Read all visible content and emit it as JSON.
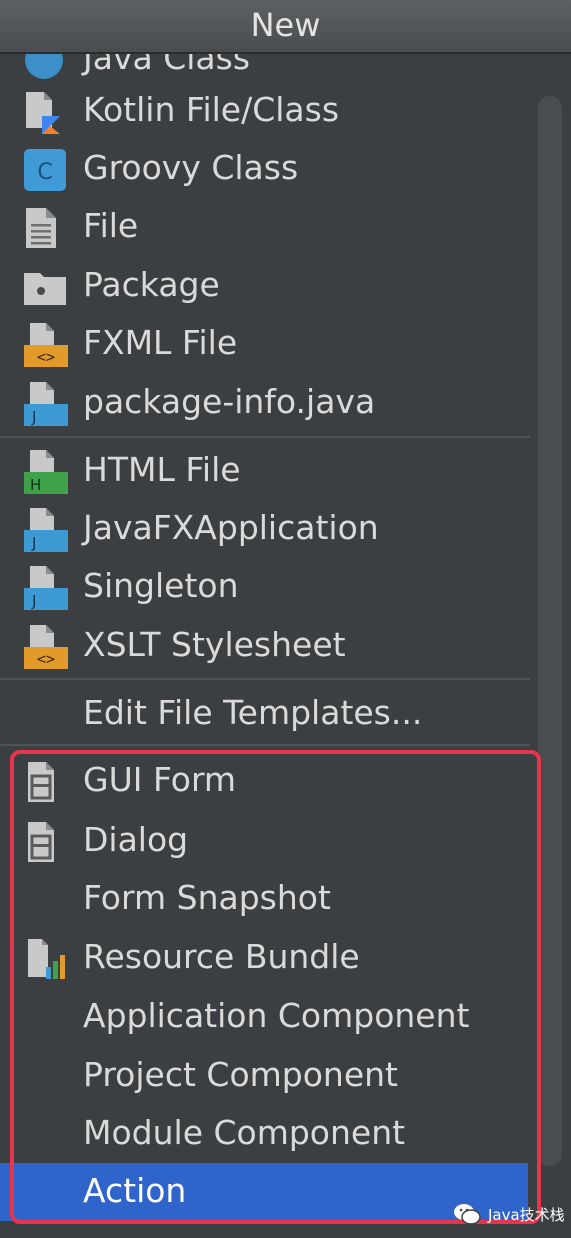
{
  "window": {
    "title": "New"
  },
  "menu": {
    "items": [
      {
        "label": "Java Class",
        "icon": "java-class-icon"
      },
      {
        "label": "Kotlin File/Class",
        "icon": "kotlin-file-icon"
      },
      {
        "label": "Groovy Class",
        "icon": "groovy-class-icon"
      },
      {
        "label": "File",
        "icon": "file-icon"
      },
      {
        "label": "Package",
        "icon": "package-folder-icon"
      },
      {
        "label": "FXML File",
        "icon": "fxml-file-icon"
      },
      {
        "label": "package-info.java",
        "icon": "java-file-icon"
      },
      {
        "label": "HTML File",
        "icon": "html-file-icon"
      },
      {
        "label": "JavaFXApplication",
        "icon": "java-file-icon"
      },
      {
        "label": "Singleton",
        "icon": "java-file-icon"
      },
      {
        "label": "XSLT Stylesheet",
        "icon": "xslt-file-icon"
      },
      {
        "label": "Edit File Templates...",
        "icon": ""
      },
      {
        "label": "GUI Form",
        "icon": "gui-form-icon"
      },
      {
        "label": "Dialog",
        "icon": "dialog-form-icon"
      },
      {
        "label": "Form Snapshot",
        "icon": ""
      },
      {
        "label": "Resource Bundle",
        "icon": "resource-bundle-icon"
      },
      {
        "label": "Application Component",
        "icon": ""
      },
      {
        "label": "Project Component",
        "icon": ""
      },
      {
        "label": "Module Component",
        "icon": ""
      },
      {
        "label": "Action",
        "icon": "",
        "selected": true
      }
    ]
  },
  "watermark": {
    "text": "Java技术栈"
  },
  "colors": {
    "background": "#3c3f41",
    "text": "#dadada",
    "selection": "#2f65ca",
    "highlight_box": "#e8344d",
    "java_blue": "#3d9ad3",
    "html_green": "#3fa14a",
    "xml_orange": "#e29a2a"
  }
}
